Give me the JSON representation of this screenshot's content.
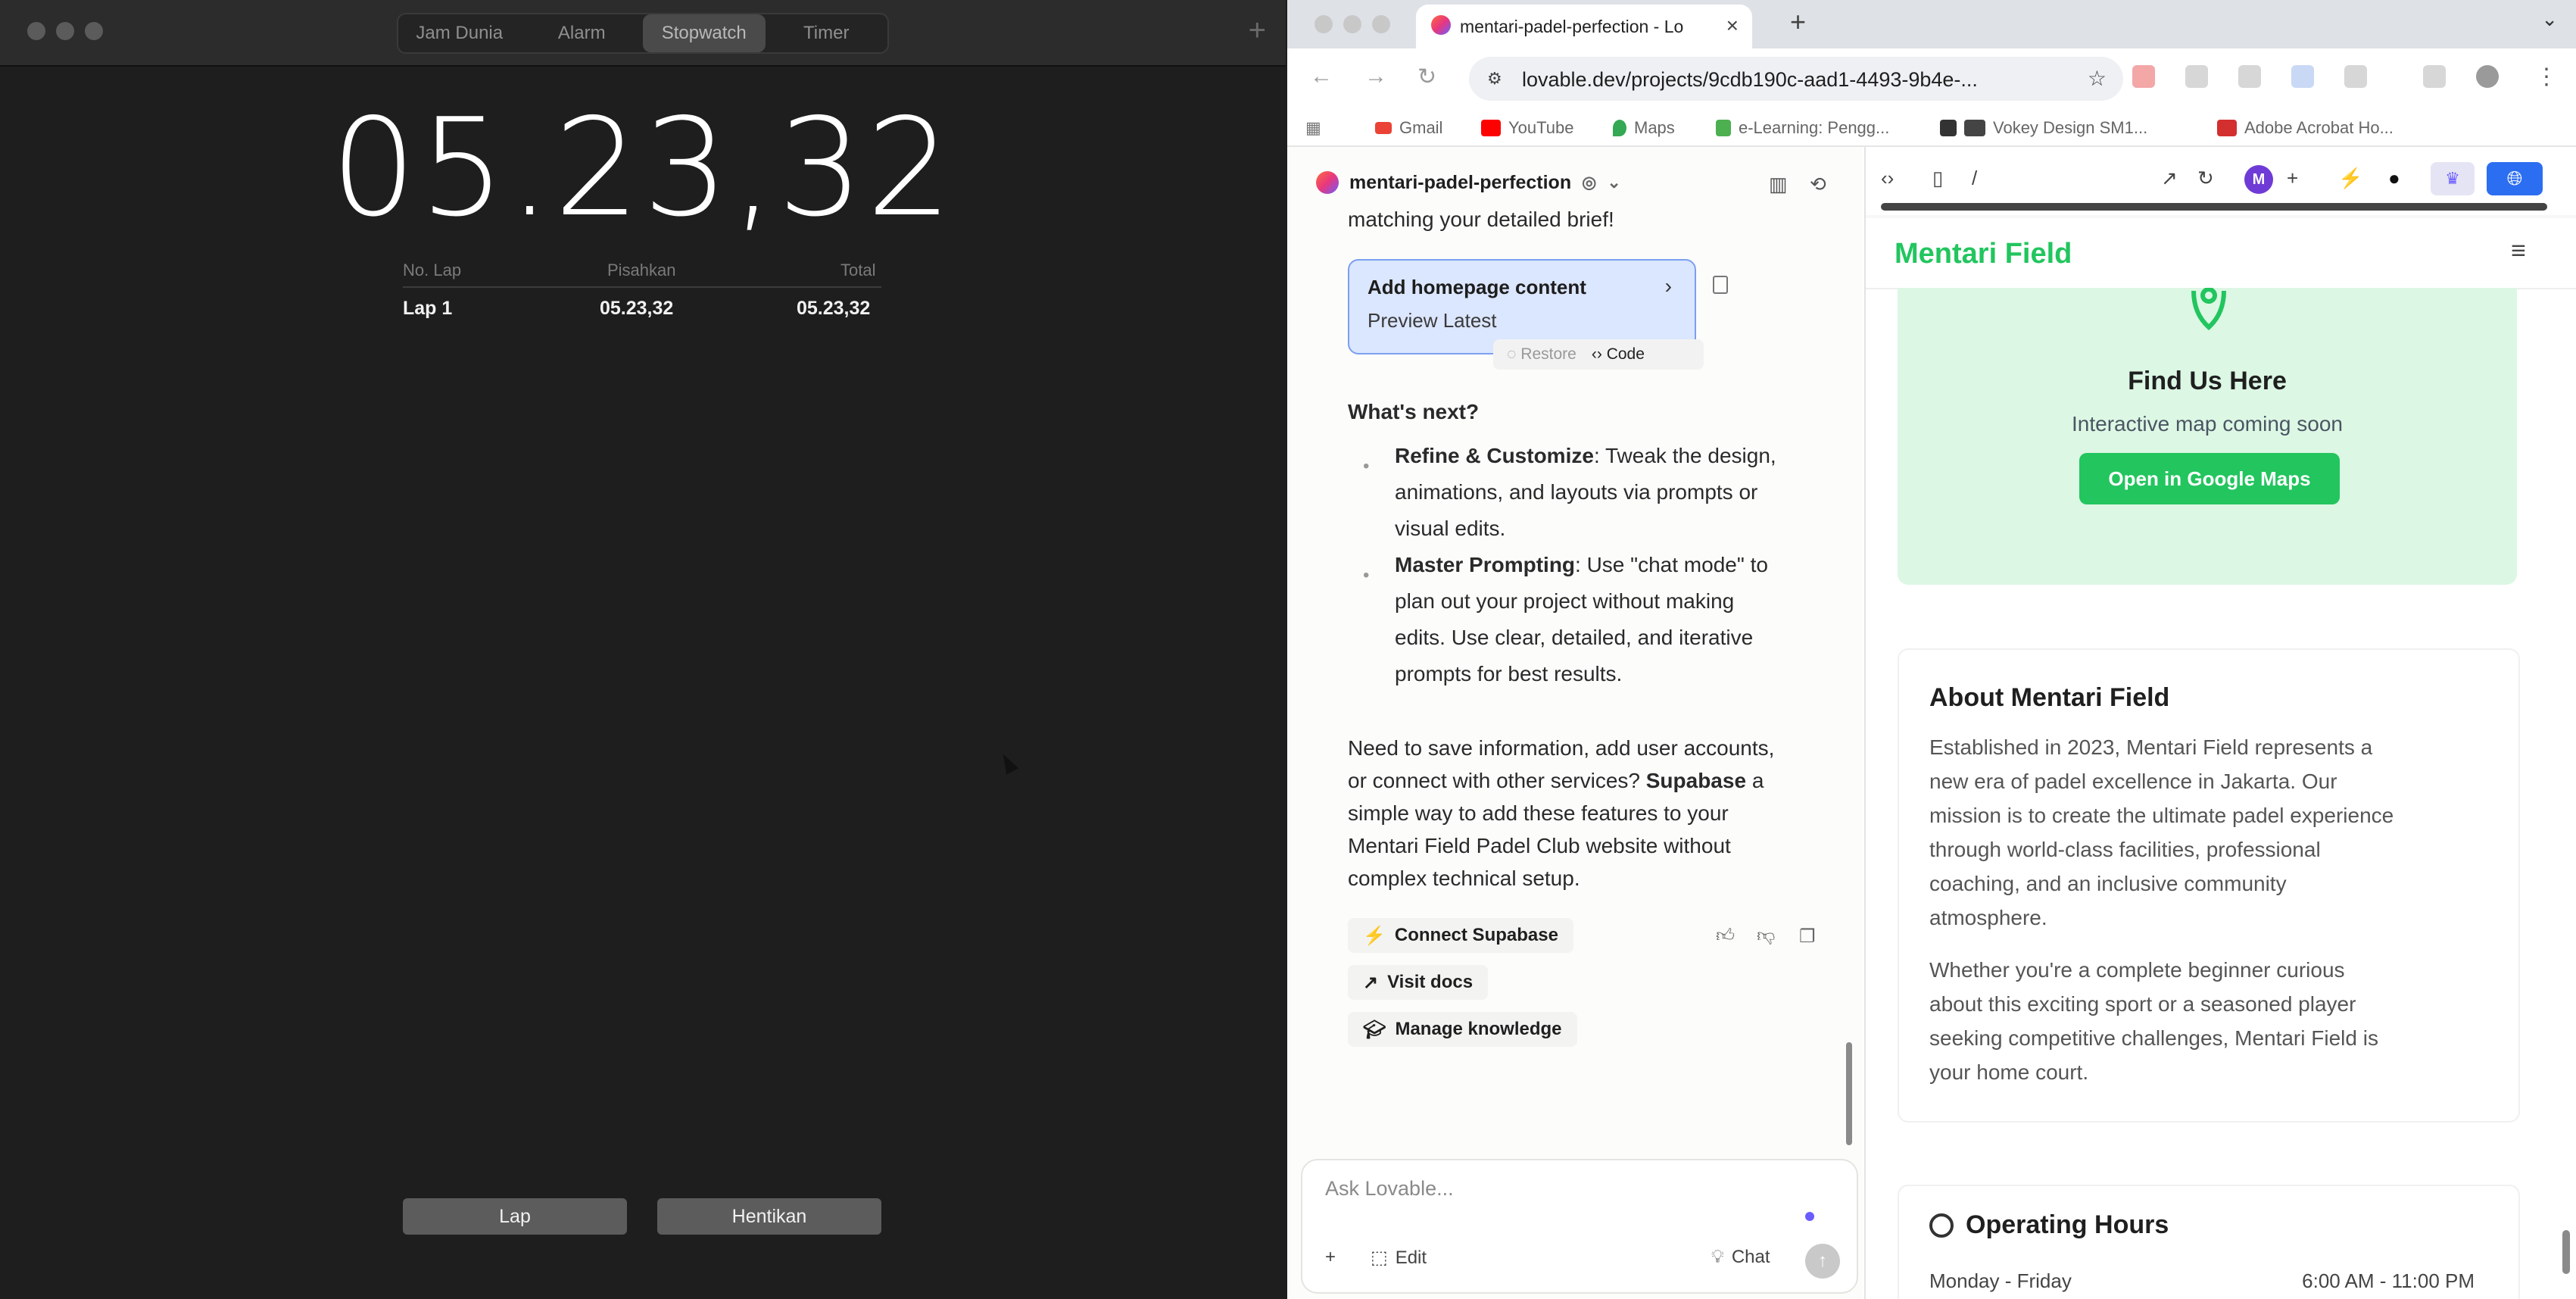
{
  "clock": {
    "tabs": [
      "Jam Dunia",
      "Alarm",
      "Stopwatch",
      "Timer"
    ],
    "active_tab": "Stopwatch",
    "time": "05.23,32",
    "lap_headers": [
      "No. Lap",
      "Pisahkan",
      "Total"
    ],
    "laps": [
      {
        "name": "Lap 1",
        "split": "05.23,32",
        "total": "05.23,32"
      }
    ],
    "lap_button": "Lap",
    "stop_button": "Hentikan",
    "add_icon": "plus-icon"
  },
  "browser": {
    "tab_title": "mentari-padel-perfection - Lo",
    "url": "lovable.dev/projects/9cdb190c-aad1-4493-9b4e-...",
    "bookmarks": [
      "Gmail",
      "YouTube",
      "Maps",
      "e-Learning: Pengg...",
      "Vokey Design SM1...",
      "Adobe Acrobat Ho..."
    ]
  },
  "lovable": {
    "project_name": "mentari-padel-perfection",
    "intro_tail": "matching your detailed brief!",
    "card_title": "Add homepage content",
    "card_sub": "Preview Latest",
    "restore_label": "Restore",
    "code_label": "Code",
    "next_heading": "What's next?",
    "bullet1_bold": "Refine & Customize",
    "bullet1_lines": [
      ": Tweak the design,",
      "animations, and layouts via prompts or",
      "visual edits."
    ],
    "bullet2_bold": "Master Prompting",
    "bullet2_lines": [
      ": Use \"chat mode\" to",
      "plan out your project without making",
      "edits. Use clear, detailed, and iterative",
      "prompts for best results."
    ],
    "para_lines": [
      "Need to save information, add user accounts,",
      "or connect with other services?",
      "a",
      "simple way to add these features to your",
      "Mentari Field Padel Club website without",
      "complex technical setup."
    ],
    "supabase_bold": "Supabase",
    "actions": [
      "Connect Supabase",
      "Visit docs",
      "Manage knowledge"
    ],
    "composer_placeholder": "Ask Lovable...",
    "edit_label": "Edit",
    "chat_label": "Chat",
    "avatar_letter": "M",
    "breadcrumb": "/"
  },
  "preview": {
    "brand": "Mentari Field",
    "find_title": "Find Us Here",
    "find_sub": "Interactive map coming soon",
    "maps_button": "Open in Google Maps",
    "about_title": "About Mentari Field",
    "about_p1": [
      "Established in 2023, Mentari Field represents a",
      "new era of padel excellence in Jakarta. Our",
      "mission is to create the ultimate padel experience",
      "through world-class facilities, professional",
      "coaching, and an inclusive community",
      "atmosphere."
    ],
    "about_p2": [
      "Whether you're a complete beginner curious",
      "about this exciting sport or a seasoned player",
      "seeking competitive challenges, Mentari Field is",
      "your home court."
    ],
    "hours_title": "Operating Hours",
    "hours_day": "Monday - Friday",
    "hours_time": "6:00 AM - 11:00 PM"
  },
  "colors": {
    "brand_green": "#22c55e",
    "publish_blue": "#2c6ef2",
    "card_blue": "#dbe6ff"
  }
}
